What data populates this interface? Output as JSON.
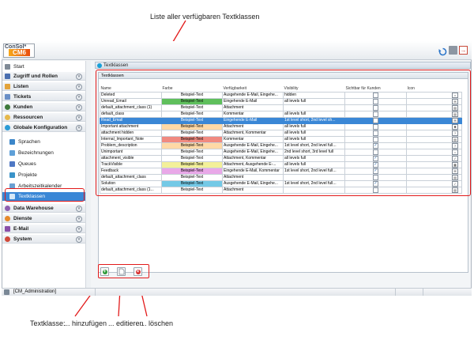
{
  "annotations": {
    "top": "Liste aller verfügbaren Textklassen",
    "bottom_prefix": "Textklasse:",
    "add": "... hinzufügen",
    "edit": "... editieren",
    "delete": "... löschen"
  },
  "app": {
    "logo_top": "ConSol*",
    "logo_bottom": "CM6",
    "user": "[CM_Administration]"
  },
  "sidebar": {
    "start": "Start",
    "groups": [
      {
        "label": "Zugriff und Rollen"
      },
      {
        "label": "Listen"
      },
      {
        "label": "Tickets"
      },
      {
        "label": "Kunden"
      },
      {
        "label": "Ressourcen"
      },
      {
        "label": "Globale Konfiguration"
      }
    ],
    "sub": [
      {
        "label": "Sprachen"
      },
      {
        "label": "Bezeichnungen"
      },
      {
        "label": "Queues"
      },
      {
        "label": "Projekte"
      },
      {
        "label": "Arbeitszeitkalender"
      },
      {
        "label": "Textklassen"
      }
    ],
    "groups2": [
      {
        "label": "Data Warehouse"
      },
      {
        "label": "Dienste"
      },
      {
        "label": "E-Mail"
      },
      {
        "label": "System"
      }
    ]
  },
  "panel": {
    "tab": "Textklassen",
    "inner_title": "Textklassen"
  },
  "table": {
    "headers": [
      "Name",
      "Farbe",
      "Verfügbarkeit",
      "Visibility",
      "Sichtbar für Kunden",
      "Icon"
    ],
    "sample": "Beispiel-Text",
    "rows": [
      {
        "name": "Deleted",
        "color": "#ffffff",
        "avail": "Ausgehende E-Mail, Eingehe...",
        "vis": "hidden",
        "cust": false,
        "icon": "×"
      },
      {
        "name": "Unread_Email",
        "color": "#5fbf5c",
        "avail": "Eingehende E-Mail",
        "vis": "all levels full",
        "cust": false,
        "icon": "✉"
      },
      {
        "name": "default_attachment_class (1)",
        "color": "#ffffff",
        "avail": "Attachment",
        "vis": "",
        "cust": false,
        "icon": "▤"
      },
      {
        "name": "default_class",
        "color": "#ffffff",
        "avail": "Kommentar",
        "vis": "all levels full",
        "cust": false,
        "icon": "▤"
      },
      {
        "name": "Read_Email",
        "color": "#ffffff",
        "avail": "Eingehende E-Mail",
        "vis": "1st level short, 2nd level sh...",
        "cust": false,
        "icon": "✉",
        "selected": true
      },
      {
        "name": "Important attachment",
        "color": "#ffd9a6",
        "avail": "Attachment",
        "vis": "all levels full",
        "cust": false,
        "icon": "✱"
      },
      {
        "name": "attachment hidden",
        "color": "#ffffff",
        "avail": "Attachment, Kommentar",
        "vis": "all levels full",
        "cust": false,
        "icon": "?"
      },
      {
        "name": "Internal_Important_Note",
        "color": "#f08a80",
        "avail": "Kommentar",
        "vis": "all levels full",
        "cust": false,
        "icon": "▤"
      },
      {
        "name": "Problem_description",
        "color": "#ffd9a6",
        "avail": "Ausgehende E-Mail, Eingehe...",
        "vis": "1st level short, 2nd level full...",
        "cust": true,
        "icon": "?"
      },
      {
        "name": "Unimportant",
        "color": "#ffffff",
        "avail": "Ausgehende E-Mail, Eingehe...",
        "vis": "2nd level short, 3rd level full",
        "cust": false,
        "icon": "○"
      },
      {
        "name": "attachment_visible",
        "color": "#ffffff",
        "avail": "Attachment, Kommentar",
        "vis": "all levels full",
        "cust": true,
        "icon": "✓"
      },
      {
        "name": "TrackVisible",
        "color": "#f3f09a",
        "avail": "Attachment, Ausgehende E-...",
        "vis": "all levels full",
        "cust": true,
        "icon": "▦"
      },
      {
        "name": "Feedback",
        "color": "#e9a8e8",
        "avail": "Eingehende E-Mail, Kommentar",
        "vis": "1st level short, 2nd level full...",
        "cust": true,
        "icon": "✉"
      },
      {
        "name": "default_attachment_class",
        "color": "#ffffff",
        "avail": "Attachment",
        "vis": "",
        "cust": false,
        "icon": "▤"
      },
      {
        "name": "Solution",
        "color": "#74c9e6",
        "avail": "Ausgehende E-Mail, Eingehe...",
        "vis": "1st level short, 2nd level full...",
        "cust": true,
        "icon": "✓"
      },
      {
        "name": "default_attachment_class (1...",
        "color": "#ffffff",
        "avail": "Attachment",
        "vis": "",
        "cust": false,
        "icon": "▤"
      }
    ]
  },
  "buttons": {
    "add_symbol": "+",
    "delete_symbol": "×"
  }
}
